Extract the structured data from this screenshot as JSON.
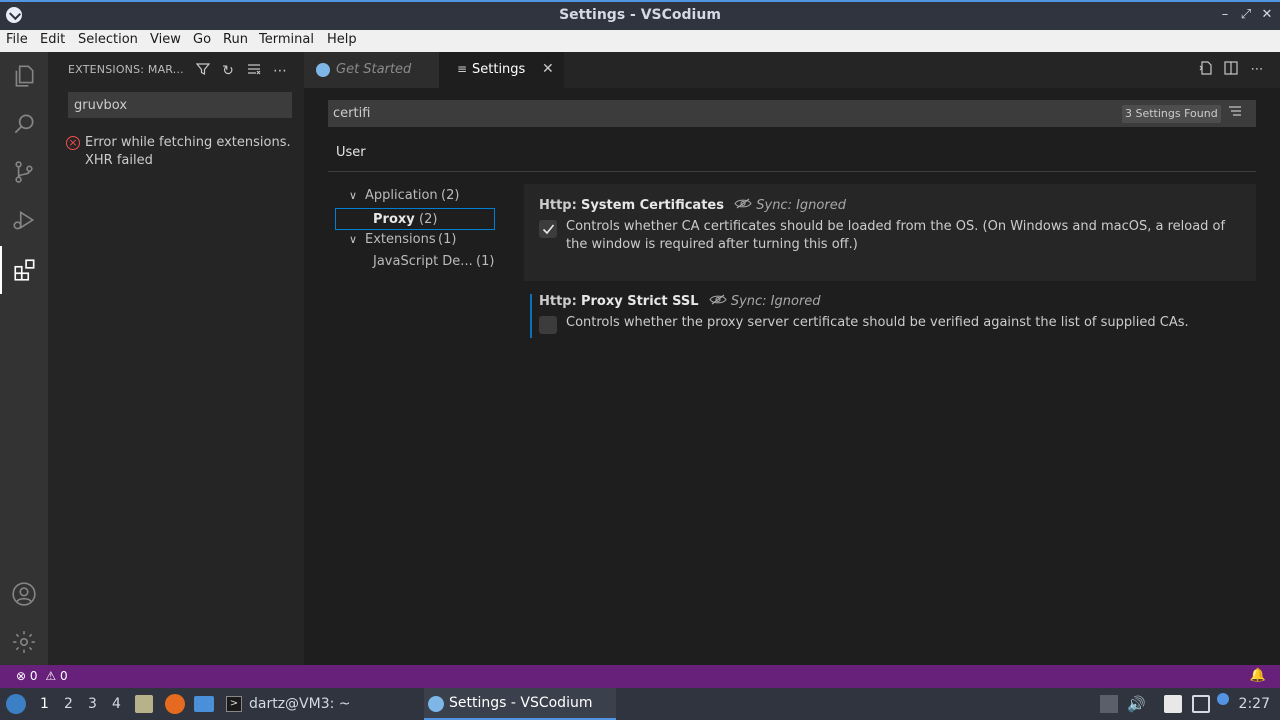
{
  "window": {
    "title": "Settings - VSCodium"
  },
  "menu": [
    "File",
    "Edit",
    "Selection",
    "View",
    "Go",
    "Run",
    "Terminal",
    "Help"
  ],
  "sidebar": {
    "header": "EXTENSIONS: MAR...",
    "search_value": "gruvbox",
    "error": "Error while fetching extensions. XHR failed"
  },
  "tabs": [
    {
      "label": "Get Started",
      "active": false
    },
    {
      "label": "Settings",
      "active": true
    }
  ],
  "settings": {
    "search_value": "certifi",
    "found": "3 Settings Found",
    "scope_tab": "User",
    "toc": {
      "application": "Application",
      "application_count": "(2)",
      "proxy": "Proxy",
      "proxy_count": "(2)",
      "extensions": "Extensions",
      "extensions_count": "(1)",
      "javascript": "JavaScript De...",
      "javascript_count": "(1)"
    },
    "items": [
      {
        "category": "Http:",
        "key": "System Certificates",
        "sync": "Sync: Ignored",
        "description": "Controls whether CA certificates should be loaded from the OS. (On Windows and macOS, a reload of the window is required after turning this off.)",
        "checked": true
      },
      {
        "category": "Http:",
        "key": "Proxy Strict SSL",
        "sync": "Sync: Ignored",
        "description": "Controls whether the proxy server certificate should be verified against the list of supplied CAs.",
        "checked": false
      }
    ]
  },
  "statusbar": {
    "errors": "0",
    "warnings": "0"
  },
  "taskbar": {
    "workspaces": [
      "1",
      "2",
      "3",
      "4"
    ],
    "terminal_label": "dartz@VM3: ~",
    "vscodium_label": "Settings - VSCodium",
    "clock": "2:27"
  },
  "colors": {
    "statusbar": "#68217a",
    "accent": "#007fd4",
    "error": "#f14c4c"
  }
}
